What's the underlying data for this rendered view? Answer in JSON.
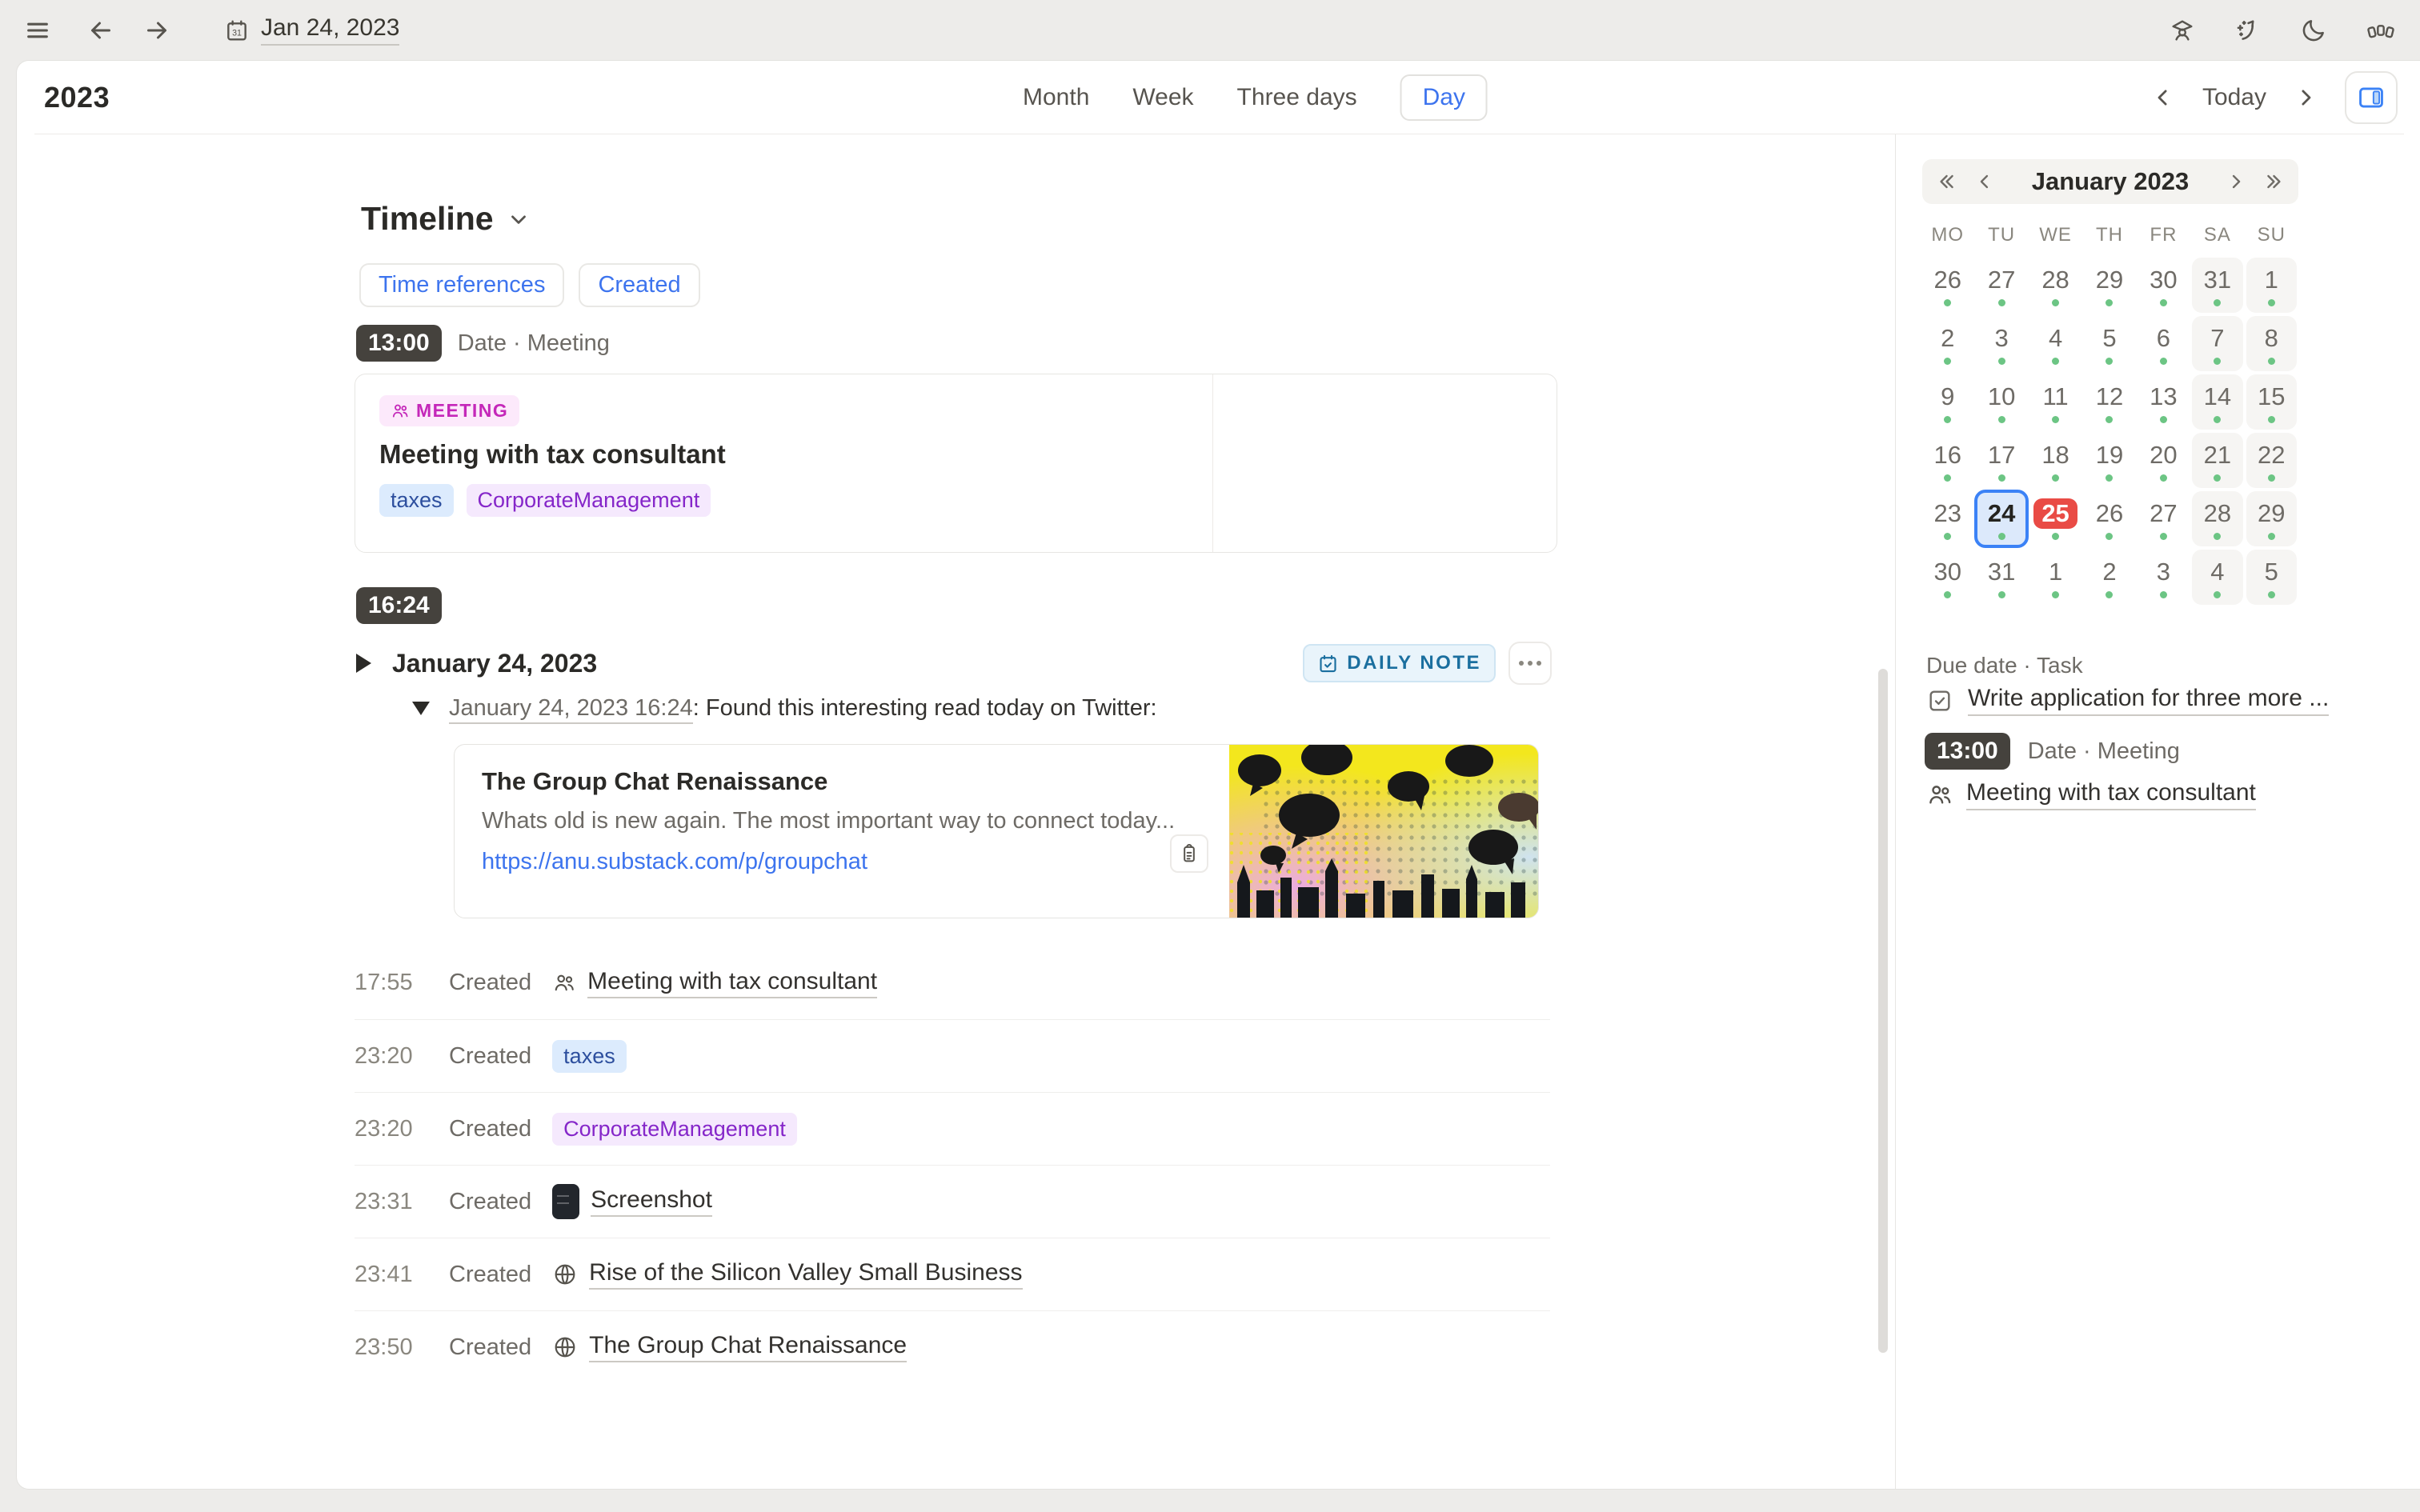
{
  "topbar": {
    "date": "Jan 24, 2023"
  },
  "header": {
    "title": "2023",
    "tabs": [
      "Month",
      "Week",
      "Three days",
      "Day"
    ],
    "active_tab": "Day",
    "today_label": "Today"
  },
  "timeline": {
    "title": "Timeline",
    "filters": [
      "Time references",
      "Created"
    ],
    "event": {
      "time": "13:00",
      "type_label": "Date · Meeting",
      "badge": "MEETING",
      "title": "Meeting with tax consultant",
      "tags": [
        {
          "label": "taxes",
          "color": "blue"
        },
        {
          "label": "CorporateManagement",
          "color": "purple"
        }
      ]
    },
    "daily_note": {
      "time": "16:24",
      "title": "January 24, 2023",
      "badge": "DAILY NOTE",
      "entry": {
        "link_text": "January 24, 2023 16:24",
        "text": ": Found this interesting read today on Twitter:"
      },
      "link_card": {
        "title": "The Group Chat Renaissance",
        "description": "Whats old is new again. The most important way to connect today...",
        "url": "https://anu.substack.com/p/groupchat"
      }
    },
    "created_items": [
      {
        "time": "17:55",
        "action": "Created",
        "kind": "link",
        "icon": "people",
        "text": "Meeting with tax consultant"
      },
      {
        "time": "23:20",
        "action": "Created",
        "kind": "chip",
        "color": "blue",
        "text": "taxes"
      },
      {
        "time": "23:20",
        "action": "Created",
        "kind": "chip",
        "color": "purple",
        "text": "CorporateManagement"
      },
      {
        "time": "23:31",
        "action": "Created",
        "kind": "link",
        "icon": "screenshot",
        "text": "Screenshot"
      },
      {
        "time": "23:41",
        "action": "Created",
        "kind": "link",
        "icon": "globe",
        "text": "Rise of the Silicon Valley Small Business"
      },
      {
        "time": "23:50",
        "action": "Created",
        "kind": "link",
        "icon": "globe",
        "text": "The Group Chat Renaissance"
      }
    ]
  },
  "sidebar": {
    "calendar": {
      "month_label": "January 2023",
      "weekdays": [
        "MO",
        "TU",
        "WE",
        "TH",
        "FR",
        "SA",
        "SU"
      ],
      "weeks": [
        [
          26,
          27,
          28,
          29,
          30,
          31,
          1
        ],
        [
          2,
          3,
          4,
          5,
          6,
          7,
          8
        ],
        [
          9,
          10,
          11,
          12,
          13,
          14,
          15
        ],
        [
          16,
          17,
          18,
          19,
          20,
          21,
          22
        ],
        [
          23,
          24,
          25,
          26,
          27,
          28,
          29
        ],
        [
          30,
          31,
          1,
          2,
          3,
          4,
          5
        ]
      ],
      "selected": {
        "week": 4,
        "col": 1,
        "day": 24
      },
      "today": {
        "week": 4,
        "col": 2,
        "day": 25
      },
      "weekend_cols": [
        5,
        6
      ],
      "dot_color": "#6cc584"
    },
    "due_task": {
      "section_label": "Due date · Task",
      "task_title": "Write application for three more ..."
    },
    "meeting_ref": {
      "time": "13:00",
      "type_label": "Date · Meeting",
      "title": "Meeting with tax consultant"
    }
  },
  "colors": {
    "accent_blue": "#3d74ee",
    "selected_day_border": "#3b82f6",
    "event_dot_green": "#6cc584",
    "today_red": "#e94b45",
    "meeting_magenta": "#c427b9",
    "tag_purple": "#8526c9",
    "tag_blue": "#2d4f9e",
    "daily_note_blue": "#1b6f9f"
  }
}
